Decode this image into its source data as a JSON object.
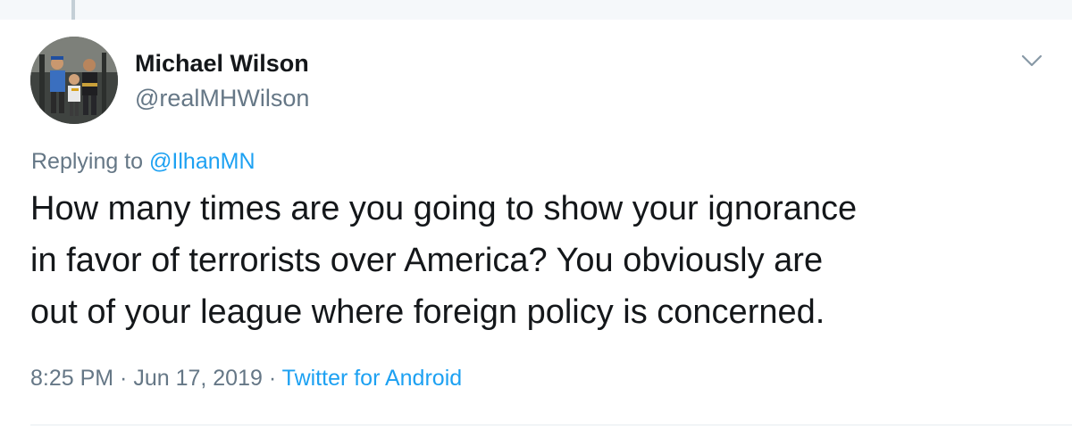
{
  "tweet": {
    "author_name": "Michael Wilson",
    "author_handle": "@realMHWilson",
    "replying_prefix": "Replying to ",
    "replying_to": "@IlhanMN",
    "text_lines": [
      "How many times are you going to show your ignorance",
      "in favor of terrorists over America? You obviously are",
      "out of your league where foreign policy is concerned."
    ],
    "time": "8:25 PM",
    "date": "Jun 17, 2019",
    "separator": " · ",
    "source": "Twitter for Android"
  },
  "icons": {
    "menu": "chevron-down-icon",
    "avatar": "profile-photo"
  },
  "colors": {
    "text_primary": "#14171a",
    "text_secondary": "#657786",
    "link": "#1da1f2",
    "divider": "#e6ecf0",
    "thread_line": "#c4cfd6"
  }
}
